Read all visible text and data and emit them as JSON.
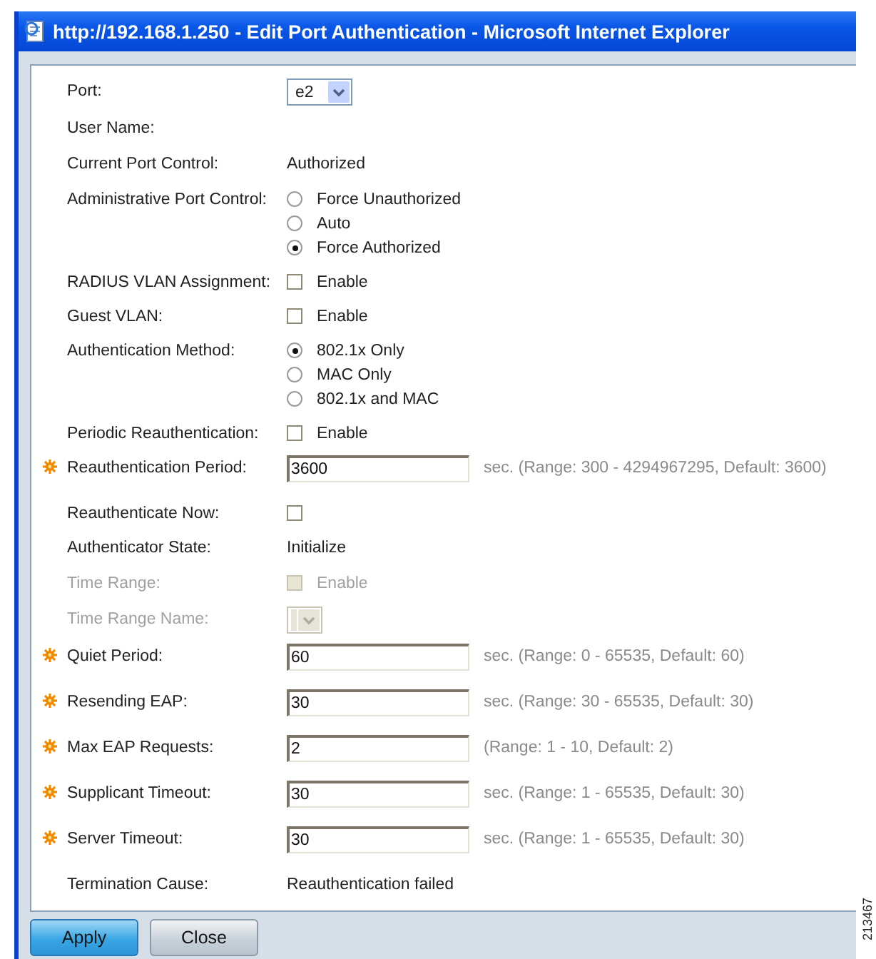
{
  "window": {
    "title": "http://192.168.1.250 - Edit Port Authentication - Microsoft Internet Explorer"
  },
  "fields": [
    {
      "kind": "select",
      "label": "Port:",
      "value": "e2",
      "required": false,
      "disabled": false
    },
    {
      "kind": "text",
      "label": "User Name:",
      "required": false,
      "disabled": false
    },
    {
      "kind": "text",
      "label": "Current Port Control:",
      "value": "Authorized",
      "required": false,
      "disabled": false
    },
    {
      "kind": "radio",
      "label": "Administrative Port Control:",
      "required": false,
      "disabled": false,
      "options": [
        {
          "label": "Force Unauthorized",
          "selected": false
        },
        {
          "label": "Auto",
          "selected": false
        },
        {
          "label": "Force Authorized",
          "selected": true
        }
      ]
    },
    {
      "kind": "checkbox",
      "label": "RADIUS VLAN Assignment:",
      "option": "Enable",
      "checked": false,
      "required": false,
      "disabled": false
    },
    {
      "kind": "checkbox",
      "label": "Guest VLAN:",
      "option": "Enable",
      "checked": false,
      "required": false,
      "disabled": false
    },
    {
      "kind": "radio",
      "label": "Authentication Method:",
      "required": false,
      "disabled": false,
      "options": [
        {
          "label": "802.1x Only",
          "selected": true
        },
        {
          "label": "MAC Only",
          "selected": false
        },
        {
          "label": "802.1x and MAC",
          "selected": false
        }
      ]
    },
    {
      "kind": "checkbox",
      "label": "Periodic Reauthentication:",
      "option": "Enable",
      "checked": false,
      "required": false,
      "disabled": false
    },
    {
      "kind": "input",
      "label": "Reauthentication Period:",
      "value": "3600",
      "hint": "sec. (Range: 300 - 4294967295, Default: 3600)",
      "required": true,
      "disabled": false
    },
    {
      "kind": "checkbox",
      "label": "Reauthenticate Now:",
      "checked": false,
      "required": false,
      "disabled": false
    },
    {
      "kind": "text",
      "label": "Authenticator State:",
      "value": "Initialize",
      "required": false,
      "disabled": false
    },
    {
      "kind": "checkbox",
      "label": "Time Range:",
      "option": "Enable",
      "checked": false,
      "required": false,
      "disabled": true
    },
    {
      "kind": "select",
      "label": "Time Range Name:",
      "required": false,
      "disabled": true
    },
    {
      "kind": "input",
      "label": "Quiet Period:",
      "value": "60",
      "hint": "sec. (Range: 0 - 65535, Default: 60)",
      "required": true,
      "disabled": false
    },
    {
      "kind": "input",
      "label": "Resending EAP:",
      "value": "30",
      "hint": "sec. (Range: 30 - 65535, Default: 30)",
      "required": true,
      "disabled": false
    },
    {
      "kind": "input",
      "label": "Max EAP Requests:",
      "value": "2",
      "hint": "(Range: 1 - 10, Default: 2)",
      "required": true,
      "disabled": false
    },
    {
      "kind": "input",
      "label": "Supplicant Timeout:",
      "value": "30",
      "hint": "sec. (Range: 1 - 65535, Default: 30)",
      "required": true,
      "disabled": false
    },
    {
      "kind": "input",
      "label": "Server Timeout:",
      "value": "30",
      "hint": "sec. (Range: 1 - 65535, Default: 30)",
      "required": true,
      "disabled": false
    },
    {
      "kind": "text",
      "label": "Termination Cause:",
      "value": "Reauthentication failed",
      "required": false,
      "disabled": false
    }
  ],
  "buttons": [
    {
      "label": "Apply",
      "primary": true
    },
    {
      "label": "Close",
      "primary": false
    }
  ],
  "figure_number": "213467"
}
